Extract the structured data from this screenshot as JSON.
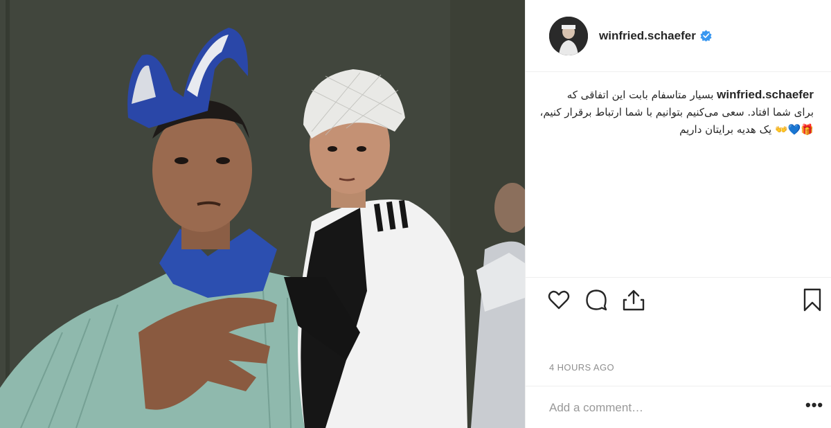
{
  "post": {
    "username": "winfried.schaefer",
    "verified": true,
    "caption_lines": [
      "بسیار متاسفام بابت این اتفاقی که",
      "برای شما افتاد. سعی می‌کنیم بتوانیم با شما ارتباط برقرار کنیم،",
      "🎁💙👐 یک هدیه برایتان داریم"
    ],
    "timestamp": "4 HOURS AGO",
    "comment_placeholder": "Add a comment…",
    "more_label": "•••"
  },
  "icons": {
    "like": "heart-icon",
    "comment": "comment-bubble-icon",
    "share": "share-icon",
    "save": "bookmark-icon",
    "verified": "verified-badge-icon"
  },
  "colors": {
    "verified_blue": "#3897f0",
    "border": "#efefef",
    "muted_text": "#8e8e8e"
  }
}
